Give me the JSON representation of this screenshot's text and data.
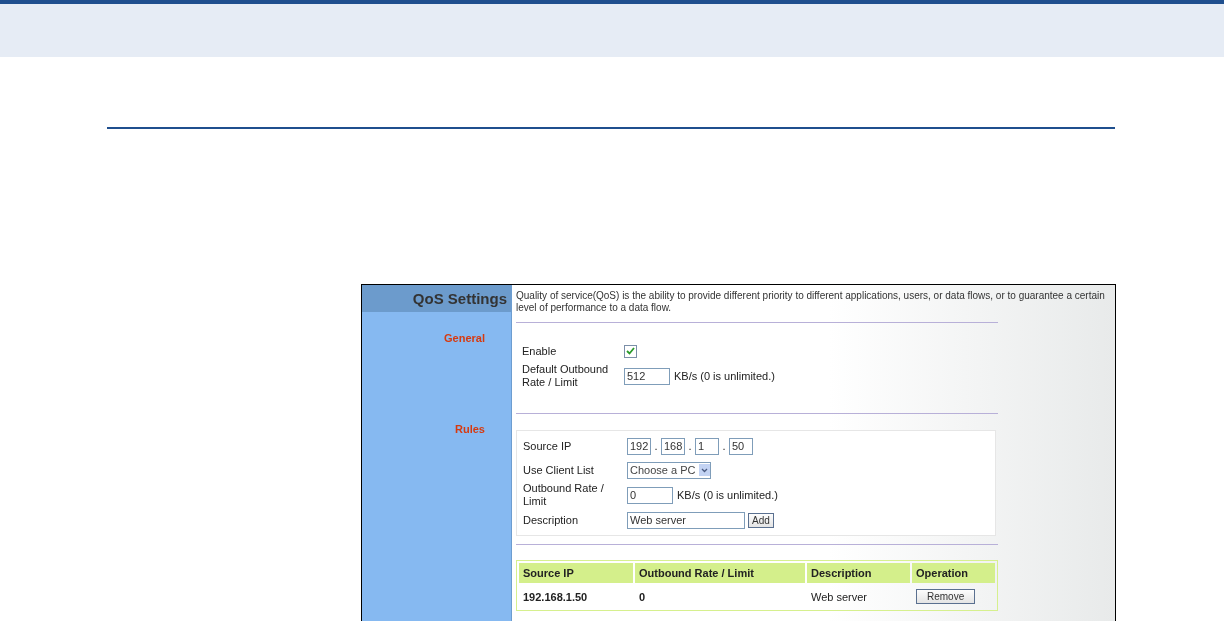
{
  "panel": {
    "title": "QoS Settings",
    "description": "Quality of service(QoS) is the ability to provide different priority to different applications, users, or data flows, or to guarantee a certain level of performance to a data flow."
  },
  "general": {
    "heading": "General",
    "enable": {
      "label": "Enable",
      "checked": true
    },
    "default_rate": {
      "label": "Default Outbound Rate / Limit",
      "value": "512",
      "unit": "KB/s (0 is unlimited.)"
    }
  },
  "rules": {
    "heading": "Rules",
    "source_ip": {
      "label": "Source IP",
      "octets": [
        "192",
        "168",
        "1",
        "50"
      ],
      "separators": [
        ".",
        ".",
        "."
      ]
    },
    "client_list": {
      "label": "Use Client List",
      "value": "Choose a PC"
    },
    "rate": {
      "label": "Outbound Rate / Limit",
      "value": "0",
      "unit": "KB/s (0 is unlimited.)"
    },
    "description": {
      "label": "Description",
      "value": "Web server"
    },
    "add_button": "Add"
  },
  "table": {
    "columns": [
      "Source IP",
      "Outbound Rate / Limit",
      "Description",
      "Operation"
    ],
    "rows": [
      {
        "cells": [
          "192.168.1.50",
          "0",
          "Web server"
        ],
        "button": "Remove"
      }
    ]
  }
}
